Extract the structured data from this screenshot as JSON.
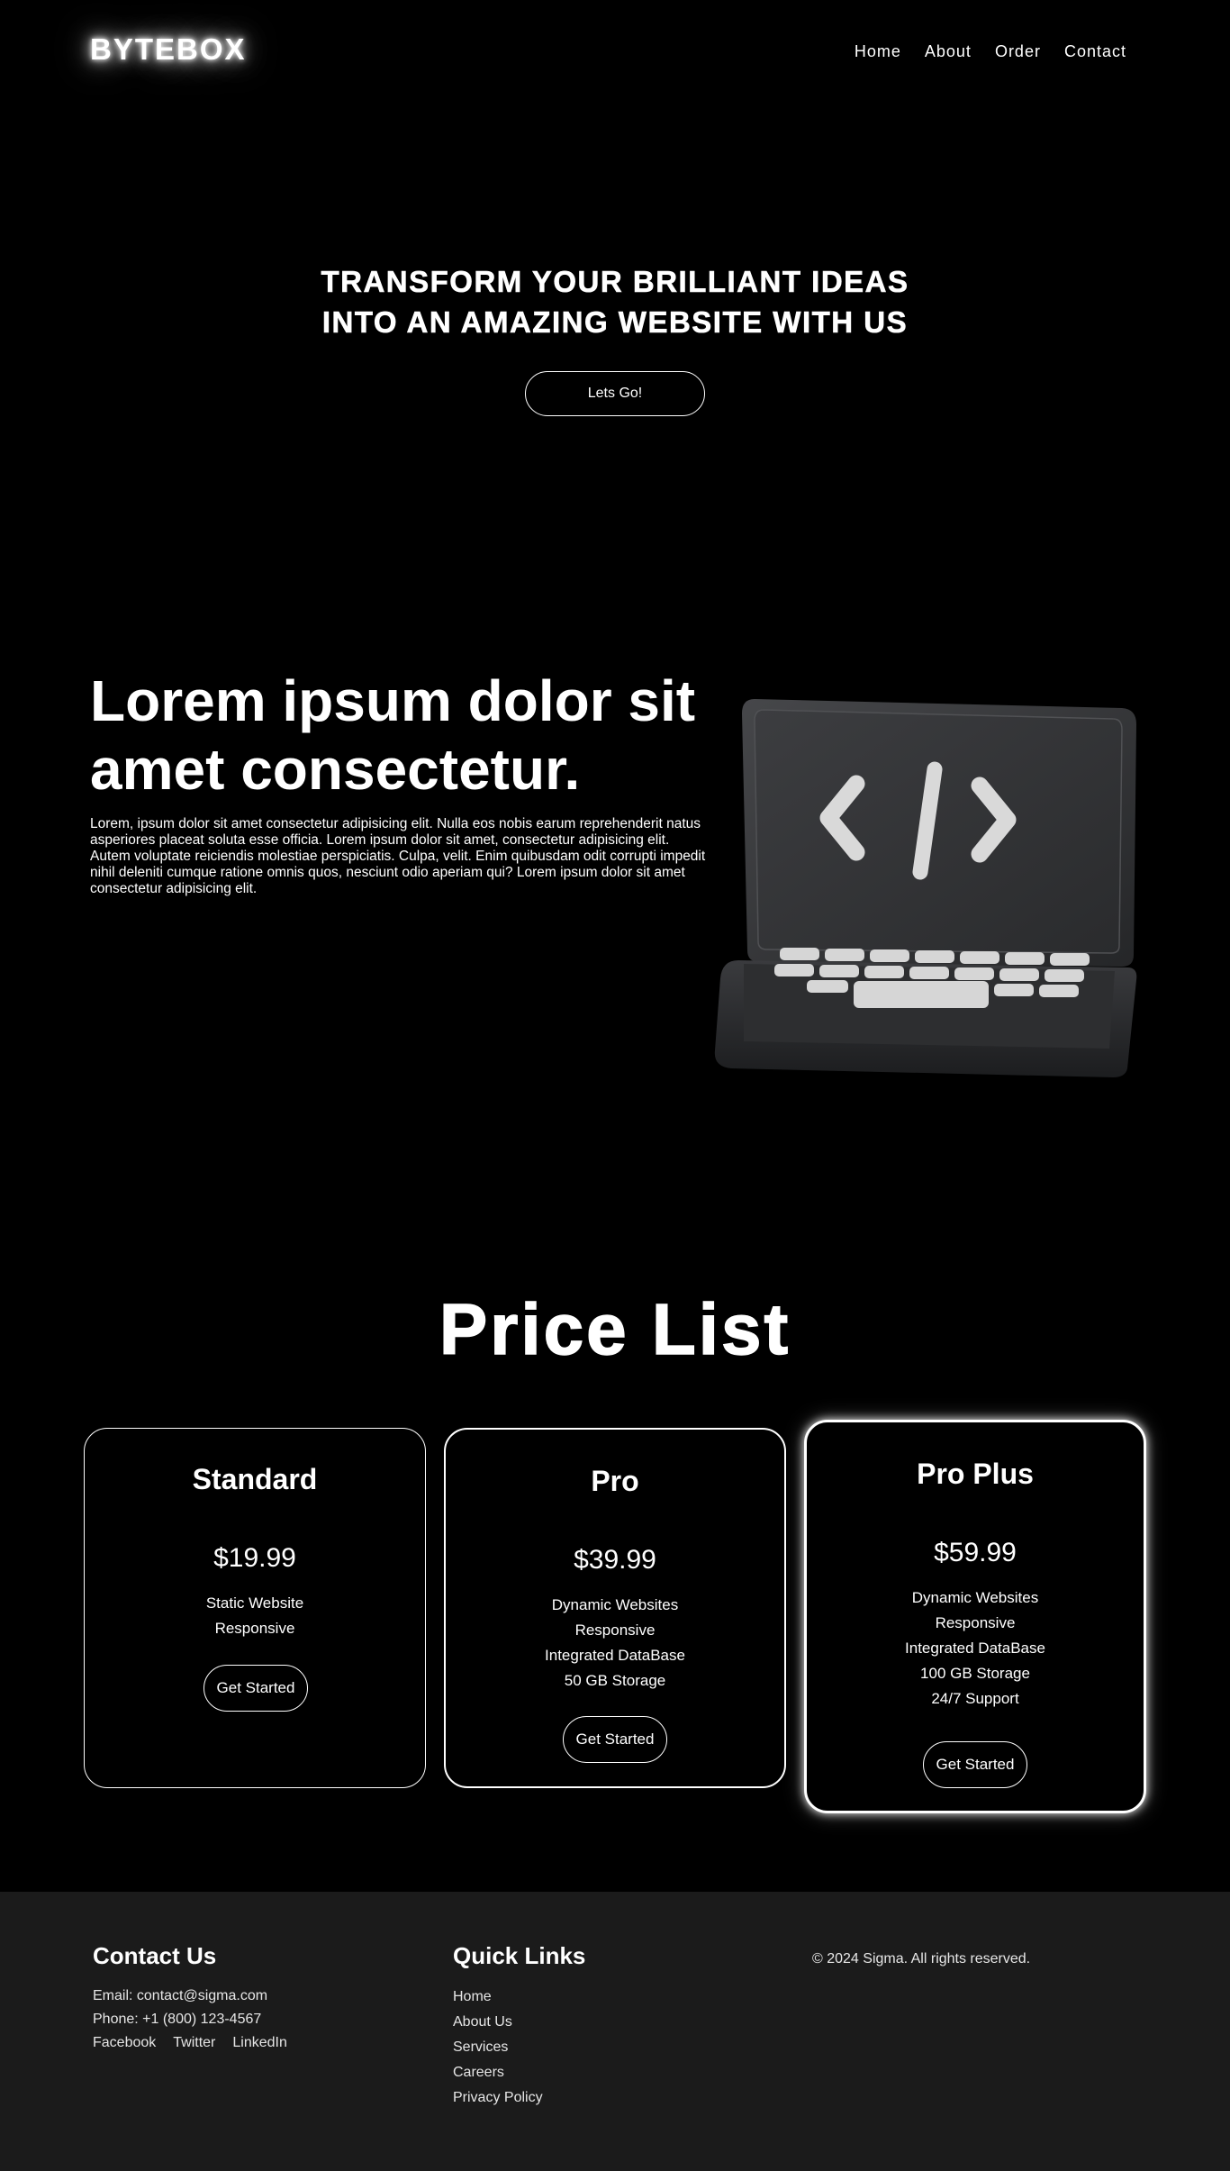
{
  "brand": {
    "logo": "BYTEBOX"
  },
  "nav": {
    "items": [
      {
        "label": "Home"
      },
      {
        "label": "About"
      },
      {
        "label": "Order"
      },
      {
        "label": "Contact"
      }
    ]
  },
  "hero": {
    "title_line1": "TRANSFORM YOUR BRILLIANT IDEAS",
    "title_line2": "INTO AN AMAZING WEBSITE WITH US",
    "cta": "Lets Go!"
  },
  "about": {
    "heading": "Lorem ipsum dolor sit amet consectetur.",
    "body": "Lorem, ipsum dolor sit amet consectetur adipisicing elit. Nulla eos nobis earum reprehenderit natus asperiores placeat soluta esse officia. Lorem ipsum dolor sit amet, consectetur adipisicing elit. Autem voluptate reiciendis molestiae perspiciatis. Culpa, velit. Enim quibusdam odit corrupti impedit nihil deleniti cumque ratione omnis quos, nesciunt odio aperiam qui? Lorem ipsum dolor sit amet consectetur adipisicing elit.",
    "image_icon": "laptop-code-icon"
  },
  "pricing": {
    "heading": "Price List",
    "plans": [
      {
        "name": "Standard",
        "price": "$19.99",
        "features": [
          "Static Website",
          "Responsive"
        ],
        "button": "Get Started"
      },
      {
        "name": "Pro",
        "price": "$39.99",
        "features": [
          "Dynamic Websites",
          "Responsive",
          "Integrated DataBase",
          "50 GB Storage"
        ],
        "button": "Get Started"
      },
      {
        "name": "Pro Plus",
        "price": "$59.99",
        "features": [
          "Dynamic Websites",
          "Responsive",
          "Integrated DataBase",
          "100 GB Storage",
          "24/7 Support"
        ],
        "button": "Get Started"
      }
    ]
  },
  "footer": {
    "contact": {
      "heading": "Contact Us",
      "email": "Email: contact@sigma.com",
      "phone": "Phone: +1 (800) 123-4567",
      "social": [
        "Facebook",
        "Twitter",
        "LinkedIn"
      ]
    },
    "quick_links": {
      "heading": "Quick Links",
      "items": [
        "Home",
        "About Us",
        "Services",
        "Careers",
        "Privacy Policy"
      ]
    },
    "copyright": "© 2024 Sigma. All rights reserved."
  },
  "colors": {
    "background": "#000000",
    "text": "#ffffff",
    "footer_bg": "#1b1b1b",
    "laptop_body": "#2e2f31",
    "laptop_keys": "#d4d4d4"
  }
}
